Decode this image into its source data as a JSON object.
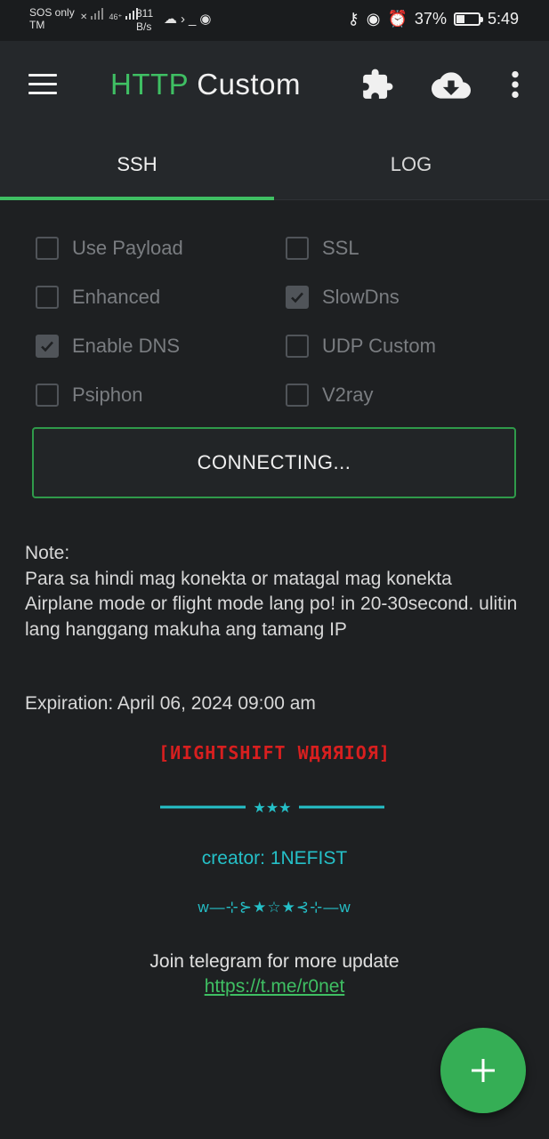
{
  "status_bar": {
    "carrier_line1": "SOS only",
    "carrier_line2": "TM",
    "signal_text": "46⁺",
    "net_speed_value": "811",
    "net_speed_unit": "B/s",
    "icons": [
      "x-icon",
      "signal-icon",
      "cloud-icon",
      "terminal-icon",
      "messenger-icon",
      "key-icon",
      "eye-icon",
      "alarm-icon"
    ],
    "battery_percent": "37%",
    "battery_level": 0.37,
    "time": "5:49"
  },
  "app_bar": {
    "title_part1": "HTTP",
    "title_part2": "Custom",
    "title_green": "#3fbf63"
  },
  "tabs": [
    {
      "label": "SSH",
      "selected": true
    },
    {
      "label": "LOG",
      "selected": false
    }
  ],
  "options": [
    {
      "label": "Use Payload",
      "checked": false
    },
    {
      "label": "SSL",
      "checked": false
    },
    {
      "label": "Enhanced",
      "checked": false
    },
    {
      "label": "SlowDns",
      "checked": true
    },
    {
      "label": "Enable DNS",
      "checked": true
    },
    {
      "label": "UDP Custom",
      "checked": false
    },
    {
      "label": "Psiphon",
      "checked": false
    },
    {
      "label": "V2ray",
      "checked": false
    }
  ],
  "connect_button": {
    "label": "CONNECTING..."
  },
  "note": {
    "heading": "Note:",
    "body": "Para sa hindi mag konekta or matagal mag konekta Airplane mode or flight mode lang po! in 20-30second. ulitin lang hanggang makuha ang tamang IP"
  },
  "expiration": "Expiration: April 06, 2024 09:00 am",
  "banner": "[ИIGHTSHIFT WДЯЯIOЯ]",
  "divider1": "★★★",
  "creator": "creator: 1NEFIST",
  "divider2": "ᴡ—⊹⊱★☆★⊰⊹—ᴡ",
  "join_text": "Join telegram for more update",
  "telegram_link": "https://t.me/r0net",
  "colors": {
    "accent": "#3fbf63",
    "teal": "#25c0c8",
    "banner_red": "#d81f1f",
    "background": "#1e2022"
  }
}
